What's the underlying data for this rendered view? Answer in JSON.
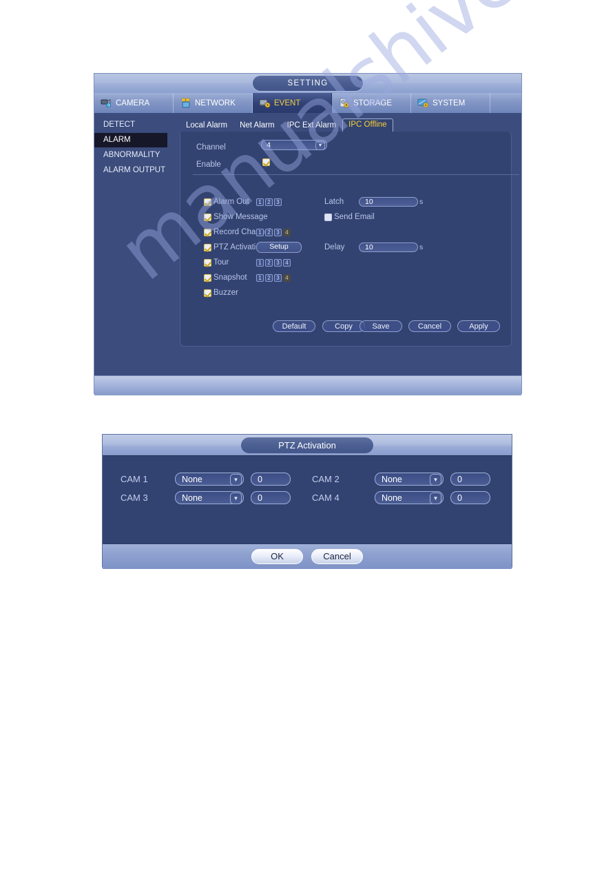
{
  "watermark": "manualshive.com",
  "setting_window": {
    "title": "SETTING",
    "nav_tabs": [
      {
        "label": "CAMERA",
        "icon": "camera-icon",
        "active": false
      },
      {
        "label": "NETWORK",
        "icon": "network-icon",
        "active": false
      },
      {
        "label": "EVENT",
        "icon": "event-icon",
        "active": true
      },
      {
        "label": "STORAGE",
        "icon": "storage-icon",
        "active": false
      },
      {
        "label": "SYSTEM",
        "icon": "system-icon",
        "active": false
      }
    ],
    "sidebar": {
      "items": [
        {
          "label": "DETECT",
          "active": false
        },
        {
          "label": "ALARM",
          "active": true
        },
        {
          "label": "ABNORMALITY",
          "active": false
        },
        {
          "label": "ALARM OUTPUT",
          "active": false
        }
      ]
    },
    "subtabs": [
      {
        "label": "Local Alarm",
        "active": false
      },
      {
        "label": "Net Alarm",
        "active": false
      },
      {
        "label": "IPC Ext Alarm",
        "active": false
      },
      {
        "label": "IPC Offline",
        "active": true
      }
    ],
    "form": {
      "channel_label": "Channel",
      "channel_value": "4",
      "enable_label": "Enable",
      "enable_checked": true,
      "options": [
        {
          "label": "Alarm Out",
          "checked": true,
          "badges": [
            "1",
            "2",
            "3"
          ],
          "badges_off": []
        },
        {
          "label": "Show Message",
          "checked": true,
          "badges": [],
          "badges_off": []
        },
        {
          "label": "Record Channel",
          "checked": true,
          "badges": [
            "1",
            "2",
            "3"
          ],
          "badges_off": [
            "4"
          ]
        },
        {
          "label": "PTZ Activation",
          "checked": true,
          "badges": [],
          "badges_off": [],
          "button": "Setup"
        },
        {
          "label": "Tour",
          "checked": true,
          "badges": [
            "1",
            "2",
            "3",
            "4"
          ],
          "badges_off": []
        },
        {
          "label": "Snapshot",
          "checked": true,
          "badges": [
            "1",
            "2",
            "3"
          ],
          "badges_off": [
            "4"
          ]
        },
        {
          "label": "Buzzer",
          "checked": true,
          "badges": [],
          "badges_off": []
        }
      ],
      "latch_label": "Latch",
      "latch_value": "10",
      "latch_unit": "s",
      "send_email_label": "Send Email",
      "send_email_checked": false,
      "delay_label": "Delay",
      "delay_value": "10",
      "delay_unit": "s"
    },
    "footer": {
      "default_label": "Default",
      "copy_label": "Copy",
      "save_label": "Save",
      "cancel_label": "Cancel",
      "apply_label": "Apply"
    }
  },
  "ptz_dialog": {
    "title": "PTZ Activation",
    "rows": [
      {
        "cam": "CAM 1",
        "mode": "None",
        "value": "0"
      },
      {
        "cam": "CAM 2",
        "mode": "None",
        "value": "0"
      },
      {
        "cam": "CAM 3",
        "mode": "None",
        "value": "0"
      },
      {
        "cam": "CAM 4",
        "mode": "None",
        "value": "0"
      }
    ],
    "ok_label": "OK",
    "cancel_label": "Cancel"
  },
  "colors": {
    "accent_yellow": "#f5cf3a",
    "panel_blue": "#334371",
    "window_blue": "#3b4c7d",
    "checkbox_border": "#e0c049"
  }
}
